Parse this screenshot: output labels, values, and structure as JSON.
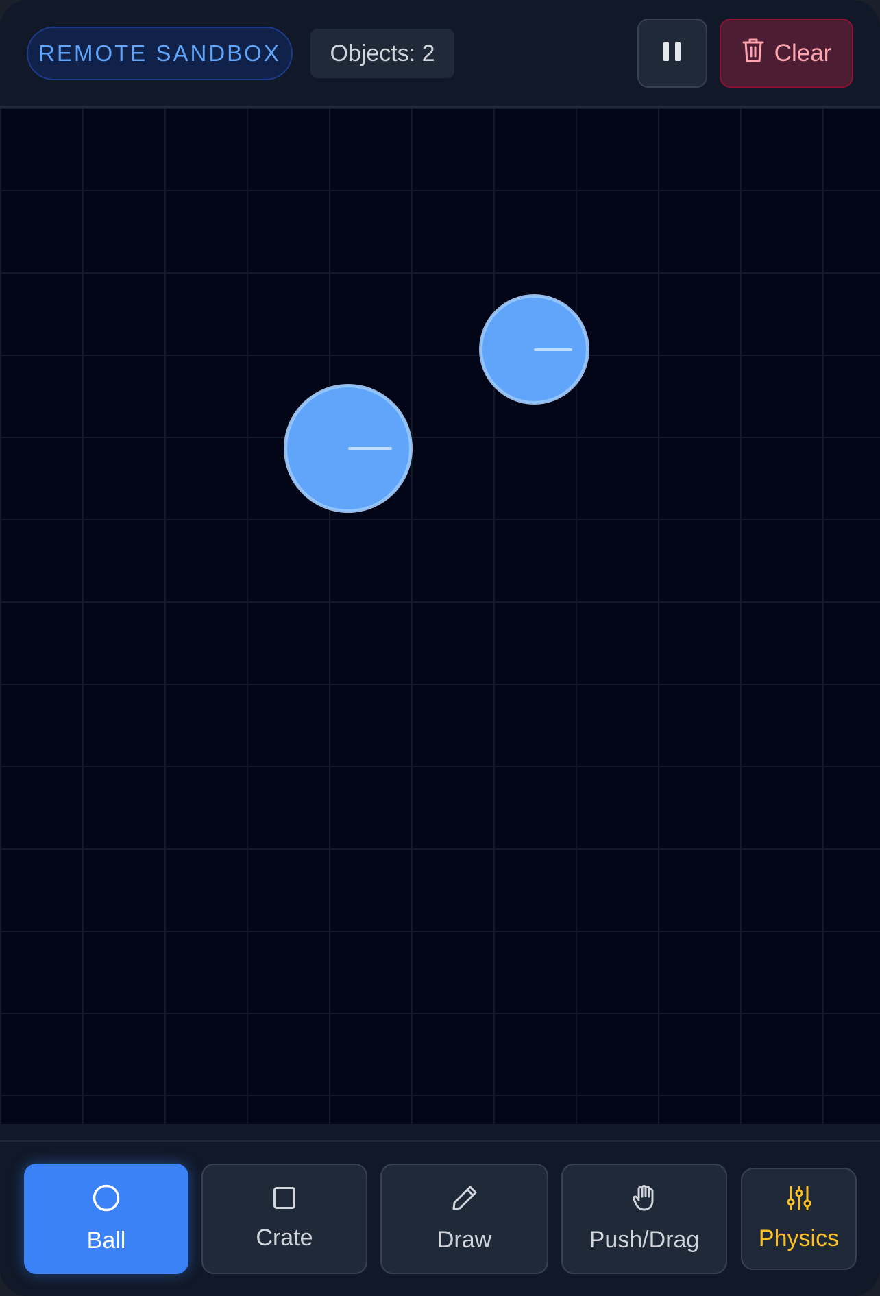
{
  "header": {
    "badge": "REMOTE SANDBOX",
    "objects_label": "Objects: 2",
    "pause_icon": "pause-icon",
    "clear_icon": "trash-icon",
    "clear_label": "Clear"
  },
  "canvas": {
    "object_type": "ball",
    "ball_color": "#60a5fa"
  },
  "toolbar": {
    "tools": [
      {
        "label": "Ball",
        "icon": "circle-icon",
        "active": true
      },
      {
        "label": "Crate",
        "icon": "square-icon",
        "active": false
      },
      {
        "label": "Draw",
        "icon": "pencil-icon",
        "active": false
      },
      {
        "label": "Push/Drag",
        "icon": "hand-icon",
        "active": false
      },
      {
        "label": "Physics",
        "icon": "sliders-icon",
        "active": false
      }
    ]
  },
  "colors": {
    "accent": "#3b82f6",
    "danger": "#fda4af",
    "physics": "#fbbf24",
    "background": "#020617"
  }
}
